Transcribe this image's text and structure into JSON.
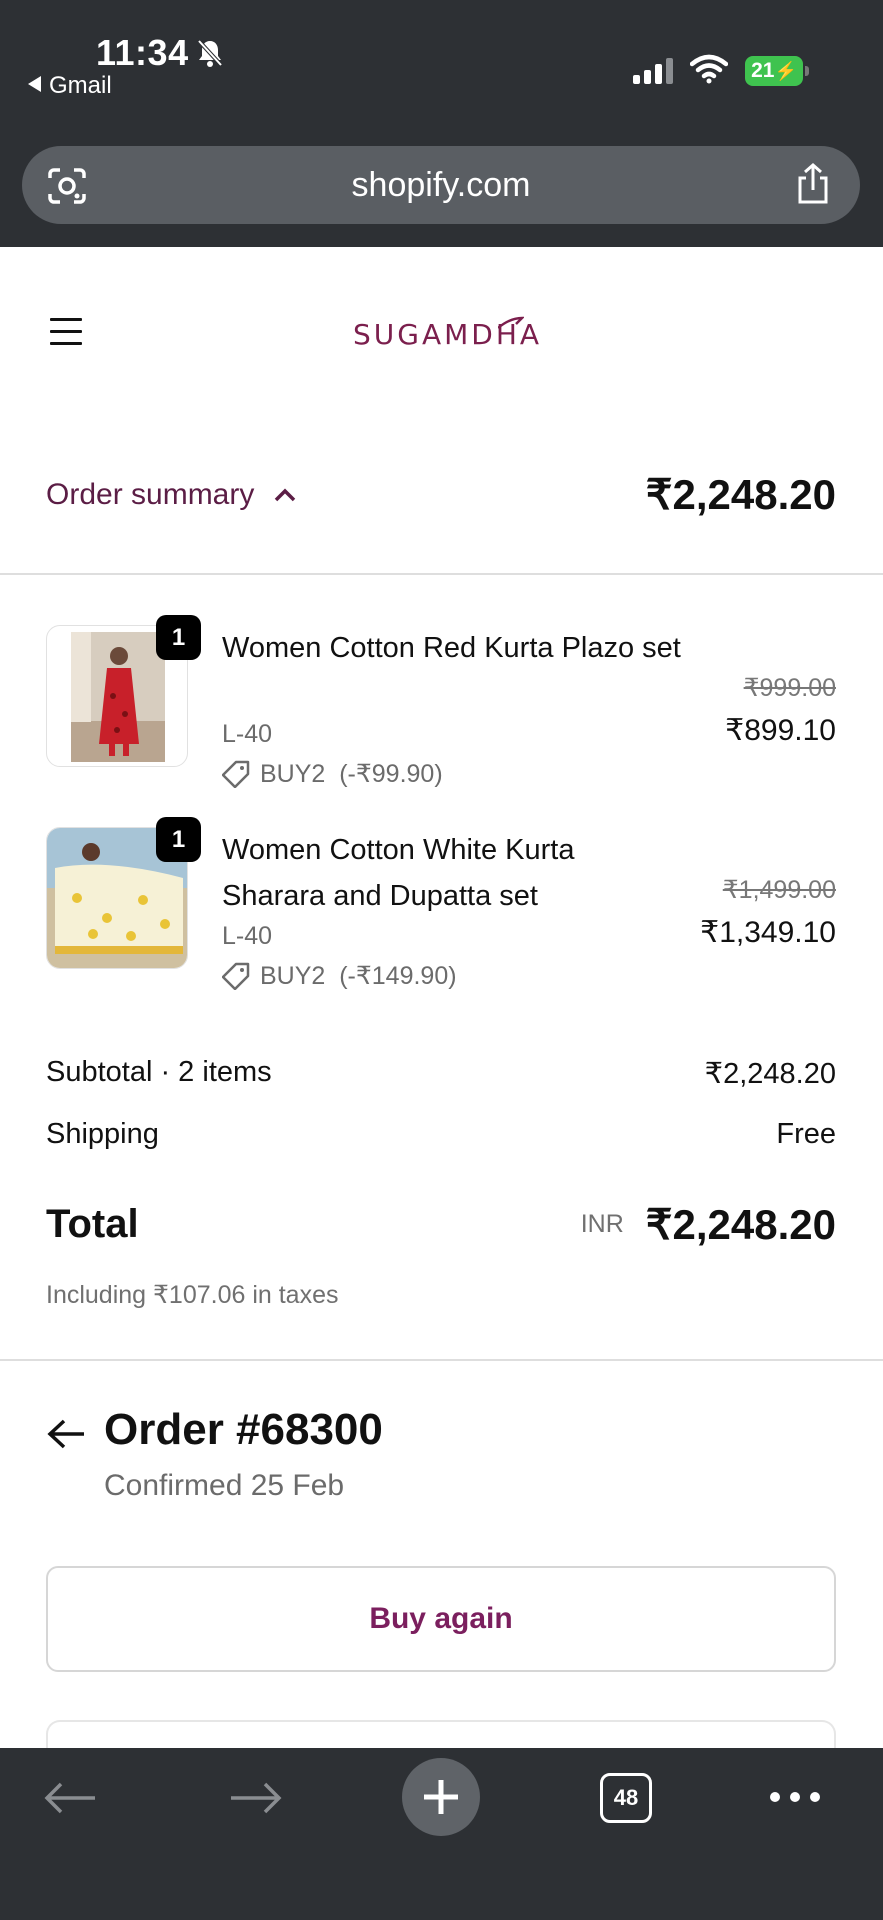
{
  "status_bar": {
    "time": "11:34",
    "back_app": "Gmail",
    "battery": "21"
  },
  "browser": {
    "url": "shopify.com",
    "tab_count": "48"
  },
  "store": {
    "logo": "SUGAMDHA"
  },
  "order_summary": {
    "toggle_label": "Order summary",
    "total": "₹2,248.20",
    "items": [
      {
        "qty": "1",
        "name": "Women Cotton Red Kurta Plazo set",
        "variant": "L-40",
        "discount": "BUY2  (-₹99.90)",
        "original_price": "₹999.00",
        "price": "₹899.10"
      },
      {
        "qty": "1",
        "name": "Women Cotton White Kurta Sharara and Dupatta set",
        "variant": "L-40",
        "discount": "BUY2  (-₹149.90)",
        "original_price": "₹1,499.00",
        "price": "₹1,349.10"
      }
    ],
    "subtotal_label": "Subtotal · 2 items",
    "subtotal": "₹2,248.20",
    "shipping_label": "Shipping",
    "shipping": "Free",
    "total_label": "Total",
    "currency": "INR",
    "grand_total": "₹2,248.20",
    "taxes_note": "Including ₹107.06 in taxes"
  },
  "order": {
    "title": "Order #68300",
    "status": "Confirmed 25 Feb",
    "buy_again": "Buy again"
  },
  "colors": {
    "brand": "#7b1f4d",
    "browser_chrome": "#2d3034",
    "badge": "#3fc34f"
  }
}
